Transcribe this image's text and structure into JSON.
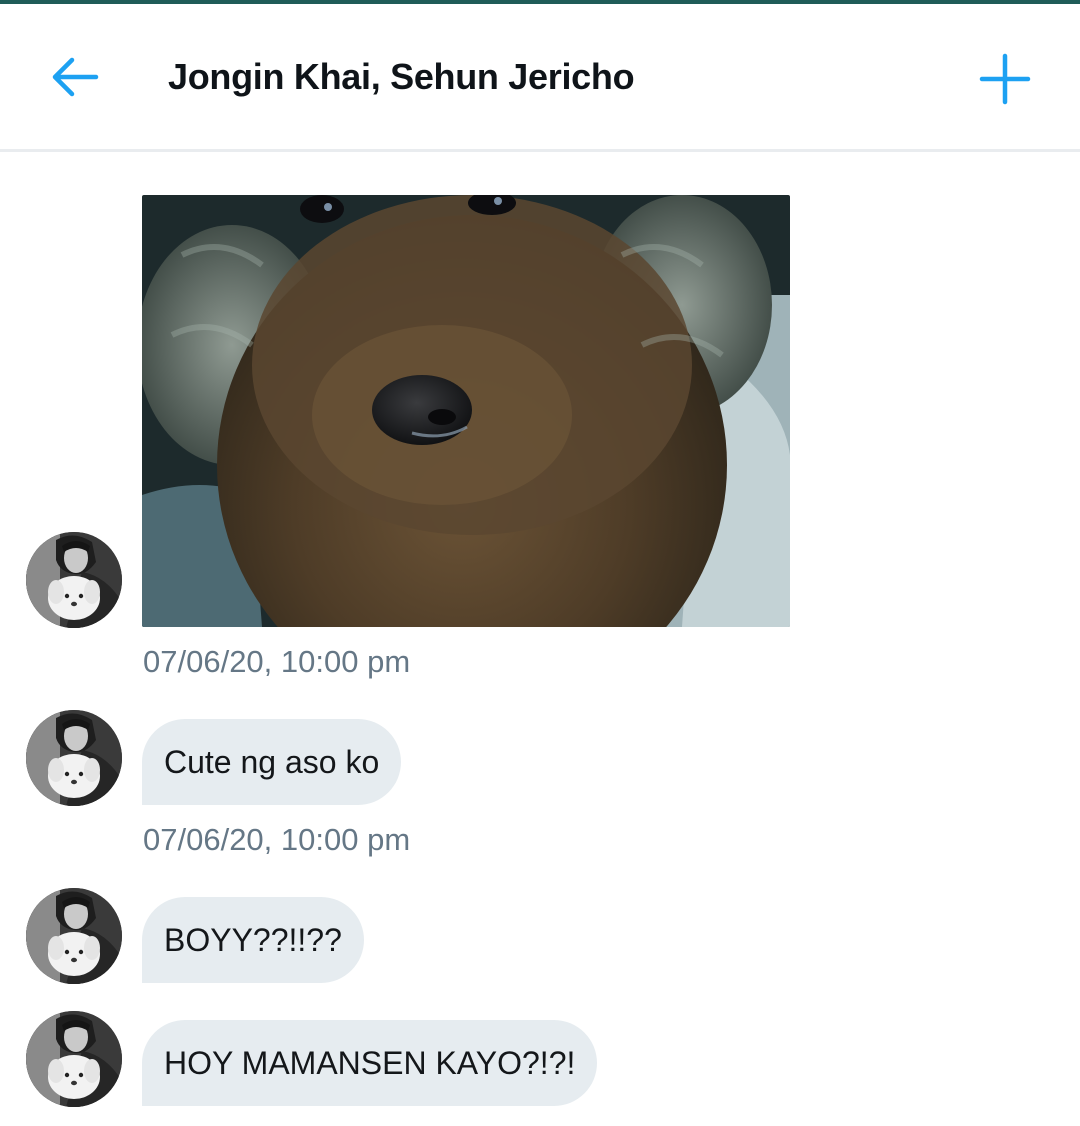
{
  "header": {
    "title": "Jongin Khai, Sehun Jericho",
    "back_icon": "arrow-left-icon",
    "add_icon": "plus-icon",
    "accent_color": "#1da1f2"
  },
  "messages": [
    {
      "type": "image",
      "image_icon": "dog-photo",
      "timestamp": "07/06/20, 10:00 pm"
    },
    {
      "type": "text",
      "text": "Cute ng aso ko",
      "timestamp": "07/06/20, 10:00 pm"
    },
    {
      "type": "text",
      "text": "BOYY??!!??"
    },
    {
      "type": "text",
      "text": "HOY MAMANSEN KAYO?!?!"
    }
  ],
  "colors": {
    "bubble_bg": "#e6ecf0",
    "timestamp": "#657786",
    "top_accent": "#1f5c58"
  }
}
